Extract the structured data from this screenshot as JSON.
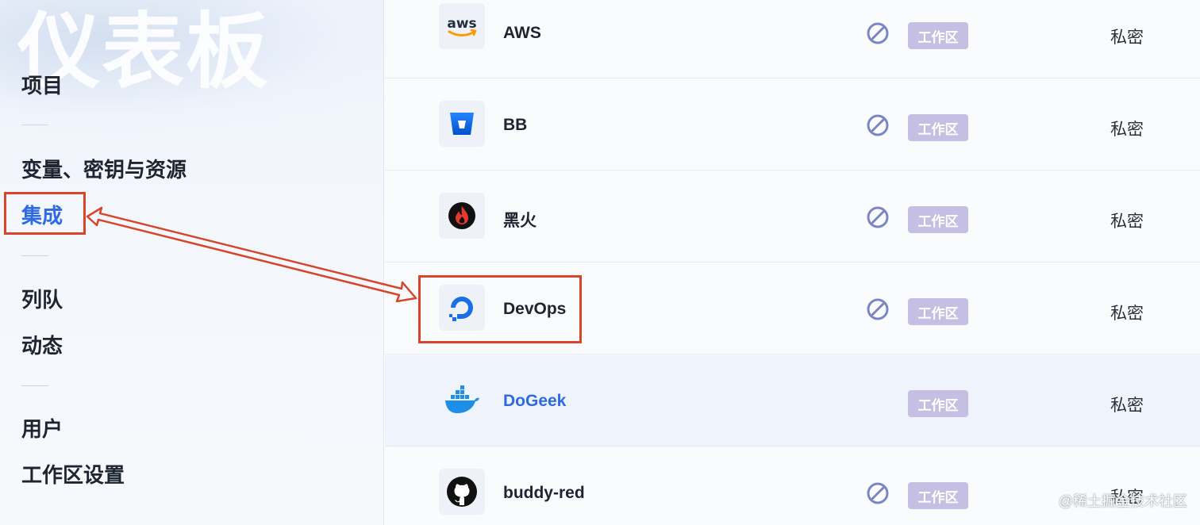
{
  "sidebar": {
    "bg_title": "仪表板",
    "items": [
      {
        "label": "项目"
      },
      {
        "label": "变量、密钥与资源"
      },
      {
        "label": "集成"
      },
      {
        "label": "列队"
      },
      {
        "label": "动态"
      },
      {
        "label": "用户"
      },
      {
        "label": "工作区设置"
      }
    ],
    "active_item": "集成"
  },
  "integrations": [
    {
      "name": "AWS",
      "logo": "aws-logo",
      "logo_text": "aws",
      "has_block_icon": true,
      "scope": "工作区",
      "privacy": "私密"
    },
    {
      "name": "BB",
      "logo": "bitbucket-logo",
      "has_block_icon": true,
      "scope": "工作区",
      "privacy": "私密"
    },
    {
      "name": "黑火",
      "logo": "blackfire-logo",
      "has_block_icon": true,
      "scope": "工作区",
      "privacy": "私密"
    },
    {
      "name": "DevOps",
      "logo": "digitalocean-logo",
      "has_block_icon": true,
      "scope": "工作区",
      "privacy": "私密"
    },
    {
      "name": "DoGeek",
      "logo": "docker-logo",
      "has_block_icon": false,
      "scope": "工作区",
      "privacy": "私密",
      "highlighted": true
    },
    {
      "name": "buddy-red",
      "logo": "github-logo",
      "has_block_icon": true,
      "scope": "工作区",
      "privacy": "私密"
    }
  ],
  "colors": {
    "accent": "#2d6ae3",
    "annotation": "#d9452b",
    "badge": "#c6bfe4",
    "block_icon": "#7b86c4"
  },
  "watermark": "@稀土掘金技术社区"
}
